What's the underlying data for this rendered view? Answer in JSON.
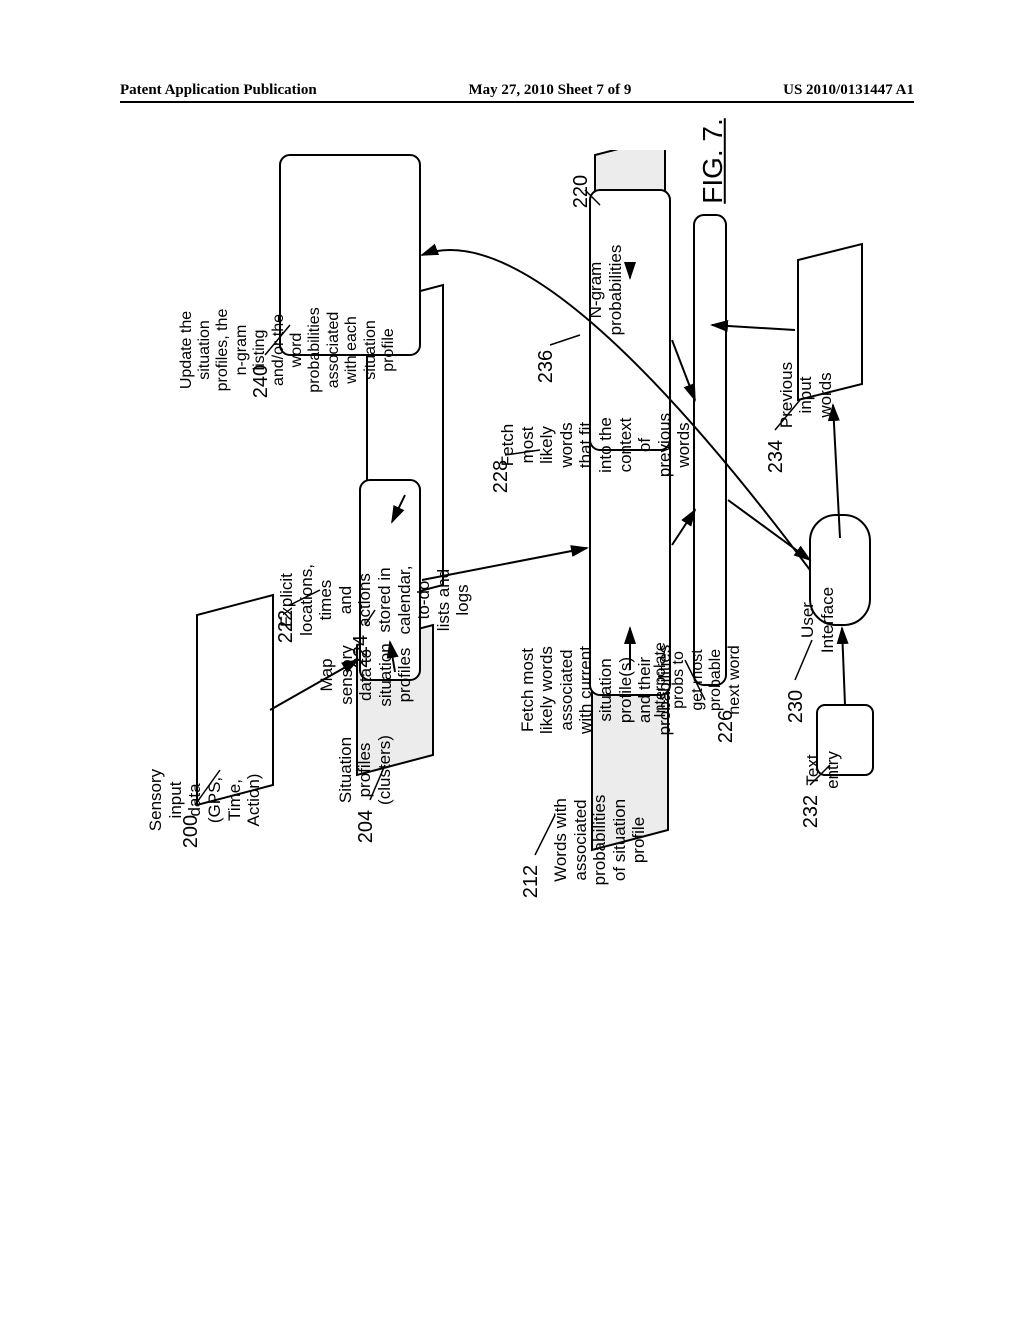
{
  "header": {
    "left": "Patent Application Publication",
    "center": "May 27, 2010  Sheet 7 of 9",
    "right": "US 2010/0131447 A1"
  },
  "labels": {
    "n200": "200",
    "n204": "204",
    "n212": "212",
    "n222": "222",
    "n224": "224",
    "n226": "226",
    "n228": "228",
    "n230": "230",
    "n232": "232",
    "n234": "234",
    "n236": "236",
    "n240": "240",
    "n220": "220"
  },
  "boxes": {
    "sensory": "Sensory input data (GPS, Time, Action)",
    "profiles": "Situation profiles (clusters)",
    "words_probs": "Words with associated probabilities of situation profile",
    "explicit": "Explicit locations, times and actions stored in calendar, to-do lists and logs",
    "map": "Map sensory data to situation profiles",
    "fetch_situation": "Fetch most likely words associated with current situation profile(s) and their probabilities",
    "interpolate": "Interpolate probs to get most probable next word",
    "fetch_context": "Fetch most likely words that fit into the context of previous words",
    "ngram": "N-gram probabilities",
    "update": "Update the situation profiles, the n-gram listing and/or the word probabilities associated with each situation profile",
    "text_entry": "Text entry",
    "user_interface": "User Interface",
    "previous_words": "Previous input words"
  },
  "figure": "FIG. 7."
}
